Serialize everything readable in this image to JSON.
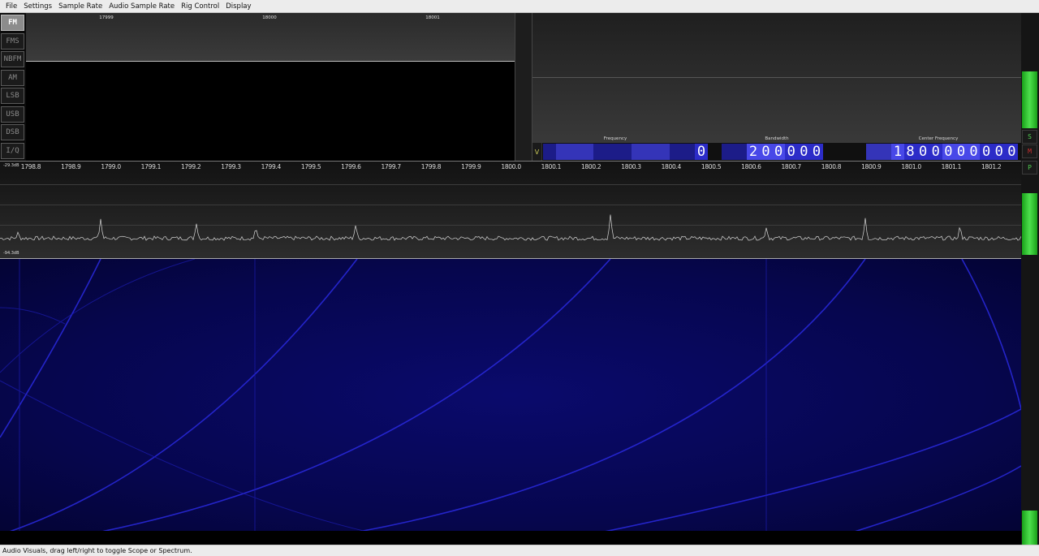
{
  "menu": [
    "File",
    "Settings",
    "Sample Rate",
    "Audio Sample Rate",
    "Rig Control",
    "Display"
  ],
  "modes": [
    "FM",
    "FMS",
    "NBFM",
    "AM",
    "LSB",
    "USB",
    "DSB",
    "I/Q"
  ],
  "active_mode": "FM",
  "audio_ticks": [
    "17999",
    "18000",
    "18001"
  ],
  "freq_bar": {
    "v_label": "V",
    "frequency_label": "Frequency",
    "bandwidth_label": "Bandwidth",
    "center_label": "Center Frequency",
    "frequency_value": "0",
    "bandwidth_value": "200000",
    "center_value": "1800000000"
  },
  "side_buttons": {
    "s": "S",
    "m": "M",
    "p": "P"
  },
  "spectrum": {
    "db_top": "-29.3dB",
    "db_bottom": "-94.3dB",
    "ticks": [
      "1798.8",
      "1798.9",
      "1799.0",
      "1799.1",
      "1799.2",
      "1799.3",
      "1799.4",
      "1799.5",
      "1799.6",
      "1799.7",
      "1799.8",
      "1799.9",
      "1800.0",
      "1800.1",
      "1800.2",
      "1800.3",
      "1800.4",
      "1800.5",
      "1800.6",
      "1800.7",
      "1800.8",
      "1800.9",
      "1801.0",
      "1801.1",
      "1801.2"
    ]
  },
  "colors": {
    "meter_green": "#3fd03f",
    "waterfall_blue": "#0a0a6c",
    "freq_blue": "#3a3ad8",
    "m_red": "#d03030",
    "s_green": "#50d050"
  },
  "status": "Audio Visuals, drag left/right to toggle Scope or Spectrum."
}
